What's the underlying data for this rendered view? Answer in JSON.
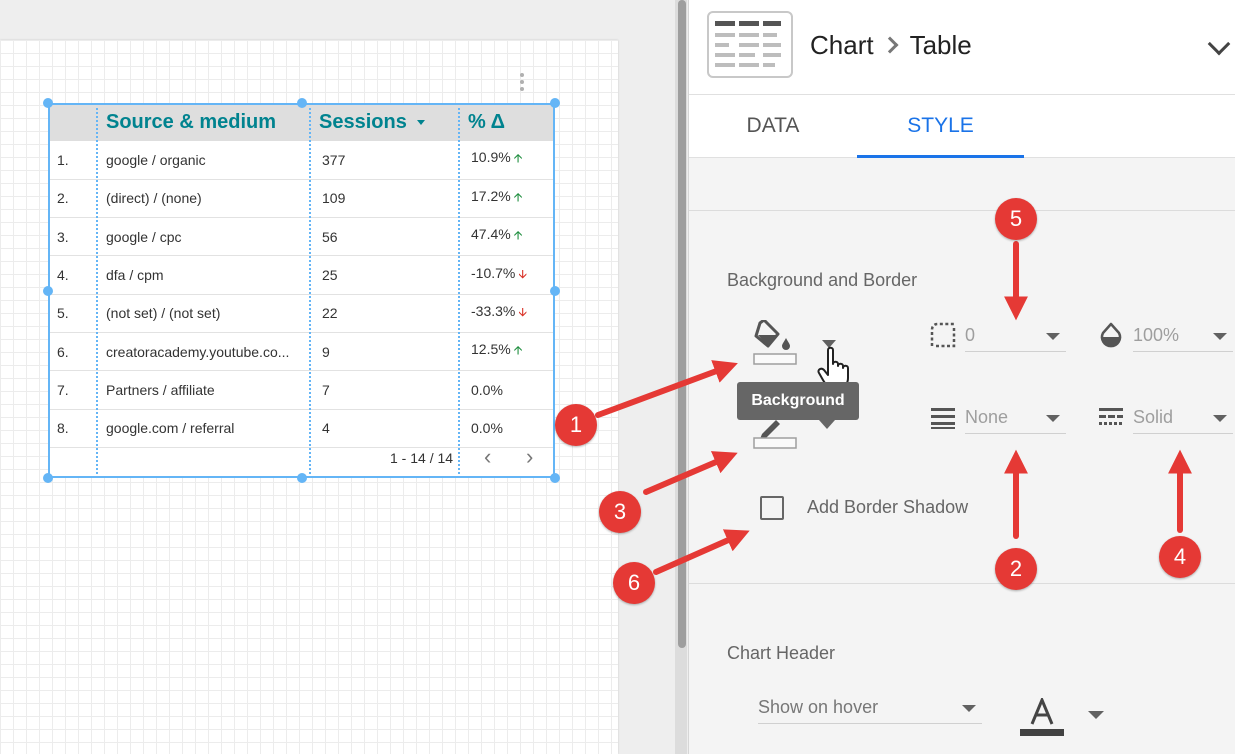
{
  "report_table": {
    "headers": [
      "Source & medium",
      "Sessions",
      "% Δ"
    ],
    "rows": [
      {
        "index": "1.",
        "source": "google / organic",
        "sessions": "377",
        "change": "10.9%",
        "trend": "up"
      },
      {
        "index": "2.",
        "source": "(direct) / (none)",
        "sessions": "109",
        "change": "17.2%",
        "trend": "up"
      },
      {
        "index": "3.",
        "source": "google / cpc",
        "sessions": "56",
        "change": "47.4%",
        "trend": "up"
      },
      {
        "index": "4.",
        "source": "dfa / cpm",
        "sessions": "25",
        "change": "-10.7%",
        "trend": "down"
      },
      {
        "index": "5.",
        "source": "(not set) / (not set)",
        "sessions": "22",
        "change": "-33.3%",
        "trend": "down"
      },
      {
        "index": "6.",
        "source": "creatoracademy.youtube.co...",
        "sessions": "9",
        "change": "12.5%",
        "trend": "up"
      },
      {
        "index": "7.",
        "source": "Partners / affiliate",
        "sessions": "7",
        "change": "0.0%",
        "trend": "none"
      },
      {
        "index": "8.",
        "source": "google.com / referral",
        "sessions": "4",
        "change": "0.0%",
        "trend": "none"
      }
    ],
    "pagination": "1 - 14 / 14"
  },
  "panel": {
    "breadcrumb_parent": "Chart",
    "breadcrumb_current": "Table",
    "tabs": {
      "data": "DATA",
      "style": "STYLE"
    },
    "background_border": {
      "title": "Background and Border",
      "border_radius": "0",
      "opacity": "100%",
      "border_weight": "None",
      "border_style": "Solid",
      "tooltip": "Background",
      "shadow_label": "Add Border Shadow"
    },
    "chart_header": {
      "title": "Chart Header",
      "value": "Show on hover"
    }
  },
  "colors": {
    "accent": "#1a73e8",
    "header_text": "#00838f",
    "selection": "#64b5f6",
    "annotation": "#e53935",
    "trend_up": "#1e8e3e",
    "trend_down": "#d93025"
  },
  "annotations": [
    "1",
    "2",
    "3",
    "4",
    "5",
    "6"
  ]
}
